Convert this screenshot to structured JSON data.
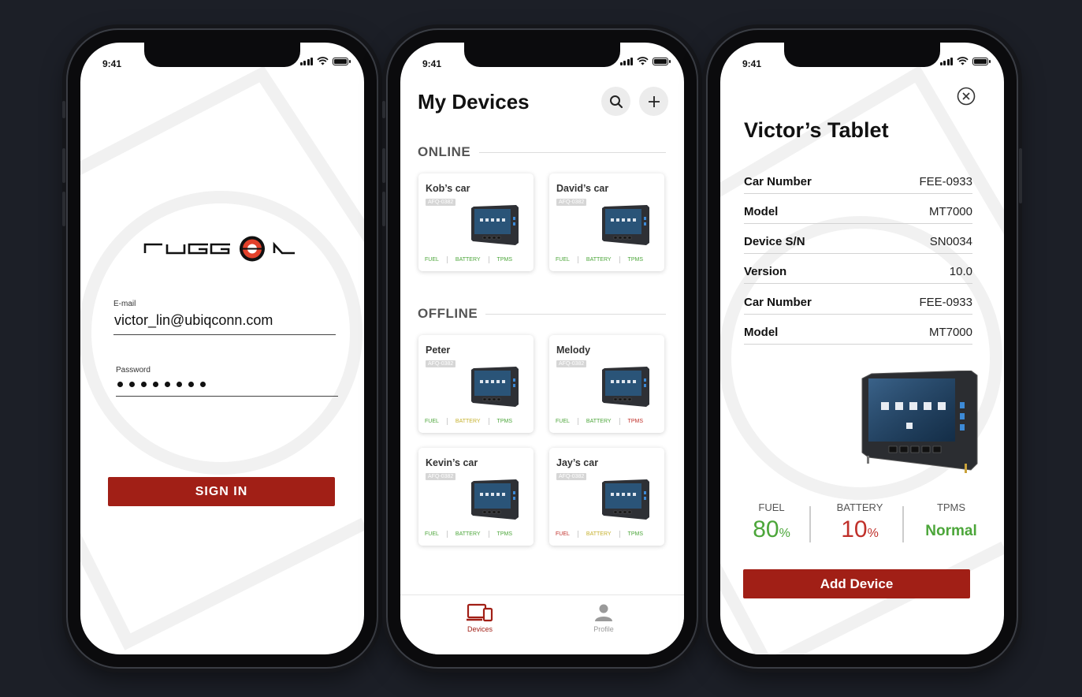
{
  "colors": {
    "background": "#1c1f27",
    "brand_red": "#a11f16",
    "good_green": "#4ca63a",
    "warn_yellow": "#c6b12e",
    "bad_red": "#c0302a"
  },
  "status_bar": {
    "time": "9:41"
  },
  "login": {
    "logo_icon": "ruggon-logo",
    "email_label": "E-mail",
    "email_value": "victor_lin@ubiqconn.com",
    "password_label": "Password",
    "password_dots": 8,
    "sign_in_label": "SIGN IN"
  },
  "devices": {
    "title": "My Devices",
    "search_icon": "search-icon",
    "add_icon": "plus-icon",
    "online_label": "ONLINE",
    "offline_label": "OFFLINE",
    "stat_labels": [
      "FUEL",
      "BATTERY",
      "TPMS"
    ],
    "online": [
      {
        "name": "Kob’s car",
        "tag": "AFQ-0382",
        "status": [
          "green",
          "green",
          "green"
        ]
      },
      {
        "name": "David’s car",
        "tag": "AFQ-0382",
        "status": [
          "green",
          "green",
          "green"
        ]
      }
    ],
    "offline": [
      {
        "name": "Peter",
        "tag": "AFQ-0382",
        "status": [
          "green",
          "yellow",
          "green"
        ]
      },
      {
        "name": "Melody",
        "tag": "AFQ-0382",
        "status": [
          "green",
          "green",
          "red"
        ]
      },
      {
        "name": "Kevin’s car",
        "tag": "AFQ-0382",
        "status": [
          "green",
          "green",
          "green"
        ]
      },
      {
        "name": "Jay’s car",
        "tag": "AFQ-0382",
        "status": [
          "red",
          "yellow",
          "green"
        ]
      }
    ],
    "tabs": [
      {
        "label": "Devices",
        "icon": "devices-icon",
        "active": true
      },
      {
        "label": "Profile",
        "icon": "profile-icon",
        "active": false
      }
    ]
  },
  "detail": {
    "title": "Victor’s Tablet",
    "close_icon": "close-circle-icon",
    "rows": [
      {
        "label": "Car Number",
        "value": "FEE-0933"
      },
      {
        "label": "Model",
        "value": "MT7000"
      },
      {
        "label": "Device S/N",
        "value": "SN0034"
      },
      {
        "label": "Version",
        "value": "10.0"
      },
      {
        "label": "Car Number",
        "value": "FEE-0933"
      },
      {
        "label": "Model",
        "value": "MT7000"
      }
    ],
    "metrics": [
      {
        "label": "FUEL",
        "value": "80",
        "unit": "%",
        "color": "green"
      },
      {
        "label": "BATTERY",
        "value": "10",
        "unit": "%",
        "color": "red"
      },
      {
        "label": "TPMS",
        "value": "Normal",
        "unit": "",
        "color": "green"
      }
    ],
    "add_device_label": "Add Device"
  }
}
